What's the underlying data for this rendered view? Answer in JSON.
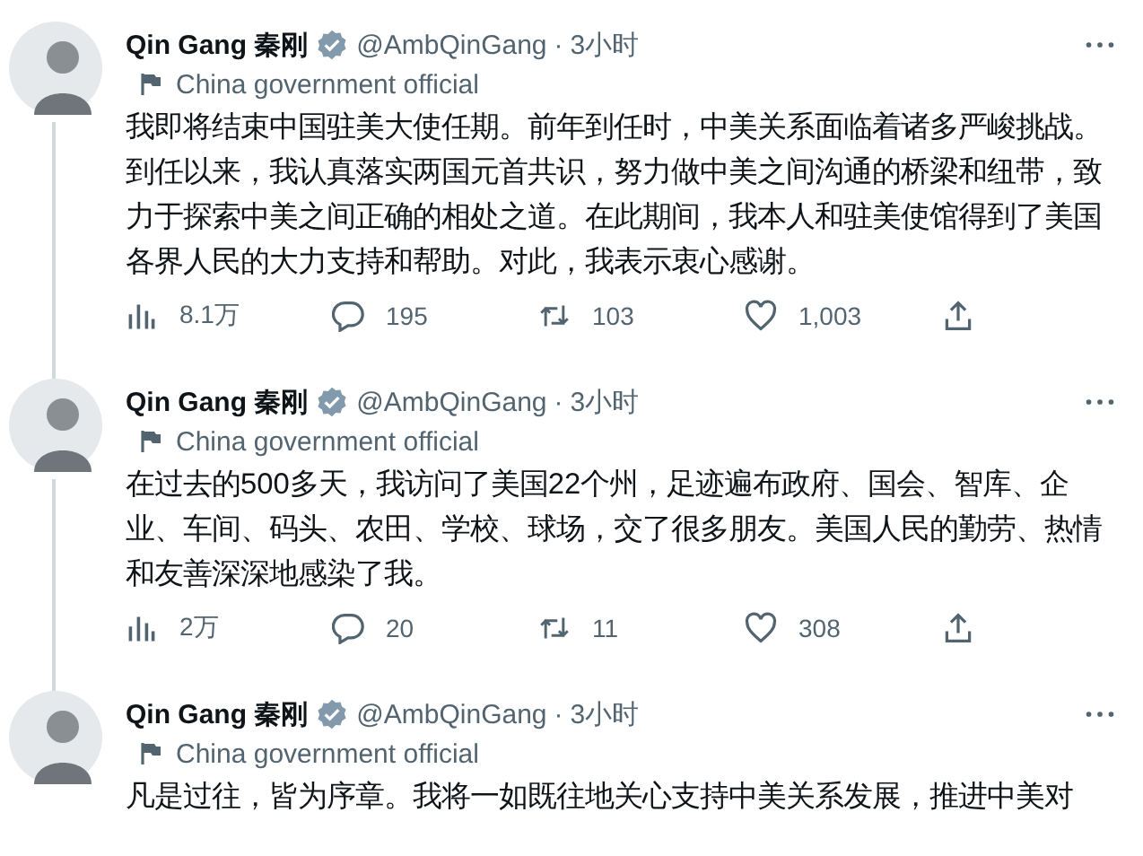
{
  "tweets": [
    {
      "author_name": "Qin Gang 秦刚",
      "verified": true,
      "handle": "@AmbQinGang",
      "separator": "·",
      "time": "3小时",
      "label": "China government official",
      "text": "我即将结束中国驻美大使任期。前年到任时，中美关系面临着诸多严峻挑战。到任以来，我认真落实两国元首共识，努力做中美之间沟通的桥梁和纽带，致力于探索中美之间正确的相处之道。在此期间，我本人和驻美使馆得到了美国各界人民的大力支持和帮助。对此，我表示衷心感谢。",
      "views": "8.1万",
      "replies": "195",
      "retweets": "103",
      "likes": "1,003"
    },
    {
      "author_name": "Qin Gang 秦刚",
      "verified": true,
      "handle": "@AmbQinGang",
      "separator": "·",
      "time": "3小时",
      "label": "China government official",
      "text": "在过去的500多天，我访问了美国22个州，足迹遍布政府、国会、智库、企业、车间、码头、农田、学校、球场，交了很多朋友。美国人民的勤劳、热情和友善深深地感染了我。",
      "views": "2万",
      "replies": "20",
      "retweets": "11",
      "likes": "308"
    },
    {
      "author_name": "Qin Gang 秦刚",
      "verified": true,
      "handle": "@AmbQinGang",
      "separator": "·",
      "time": "3小时",
      "label": "China government official",
      "text": "凡是过往，皆为序章。我将一如既往地关心支持中美关系发展，推进中美对"
    }
  ]
}
